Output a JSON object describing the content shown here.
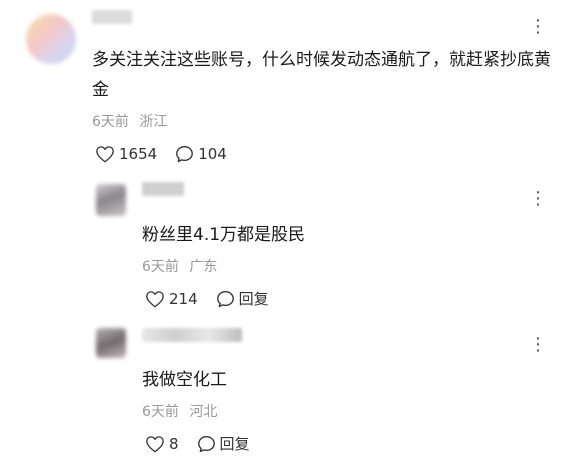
{
  "comments": [
    {
      "text": "多关注关注这些账号，什么时候发动态通航了，就赶紧抄底黄金",
      "time": "6天前",
      "location": "浙江",
      "likes": "1654",
      "replies": "104",
      "more_icon": "more-vertical-icon"
    },
    {
      "text": "粉丝里4.1万都是股民",
      "time": "6天前",
      "location": "广东",
      "likes": "214",
      "reply_label": "回复",
      "more_icon": "more-vertical-icon"
    },
    {
      "text": "我做空化工",
      "time": "6天前",
      "location": "河北",
      "likes": "8",
      "reply_label": "回复",
      "more_icon": "more-vertical-icon"
    }
  ],
  "icons": {
    "like": "heart-outline-icon",
    "comment": "speech-bubble-icon"
  },
  "colors": {
    "text": "#1a1a1a",
    "meta": "#999999",
    "action": "#333333"
  }
}
